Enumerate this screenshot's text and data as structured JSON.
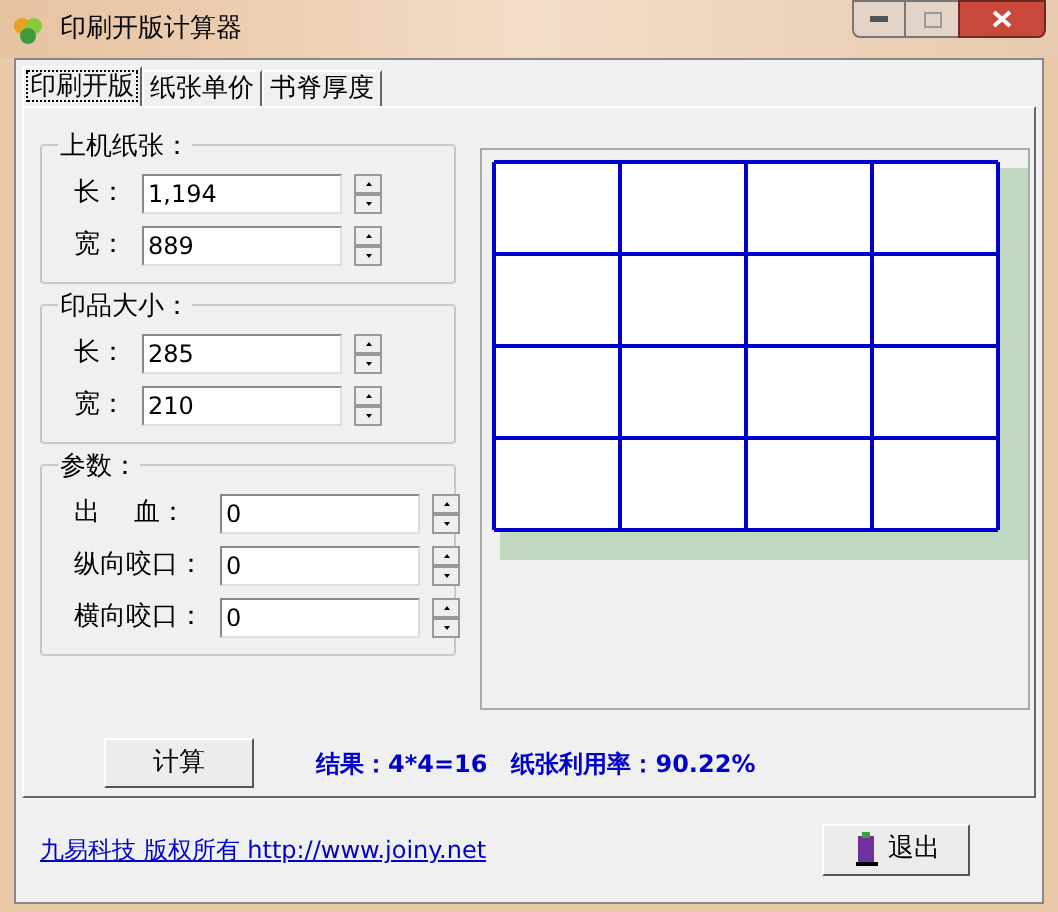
{
  "window": {
    "title": "印刷开版计算器"
  },
  "tabs": [
    {
      "label": "印刷开版",
      "selected": true
    },
    {
      "label": "纸张单价",
      "selected": false
    },
    {
      "label": "书脊厚度",
      "selected": false
    }
  ],
  "groups": [
    {
      "title": "上机纸张：",
      "fields": [
        {
          "label": "长：",
          "value": "1,194"
        },
        {
          "label": "宽：",
          "value": "889"
        }
      ]
    },
    {
      "title": "印品大小：",
      "fields": [
        {
          "label": "长：",
          "value": "285"
        },
        {
          "label": "宽：",
          "value": "210"
        }
      ]
    },
    {
      "title": "参数：",
      "fields": [
        {
          "label": "出　 血：",
          "value": "0"
        },
        {
          "label": "纵向咬口：",
          "value": "0"
        },
        {
          "label": "横向咬口：",
          "value": "0"
        }
      ]
    }
  ],
  "calc_button": "计算",
  "result": {
    "count": "结果：4*4=16",
    "usage": "纸张利用率：90.22%"
  },
  "footer": {
    "link": "九易科技 版权所有 http://www.joiny.net",
    "exit_button": "退出"
  }
}
